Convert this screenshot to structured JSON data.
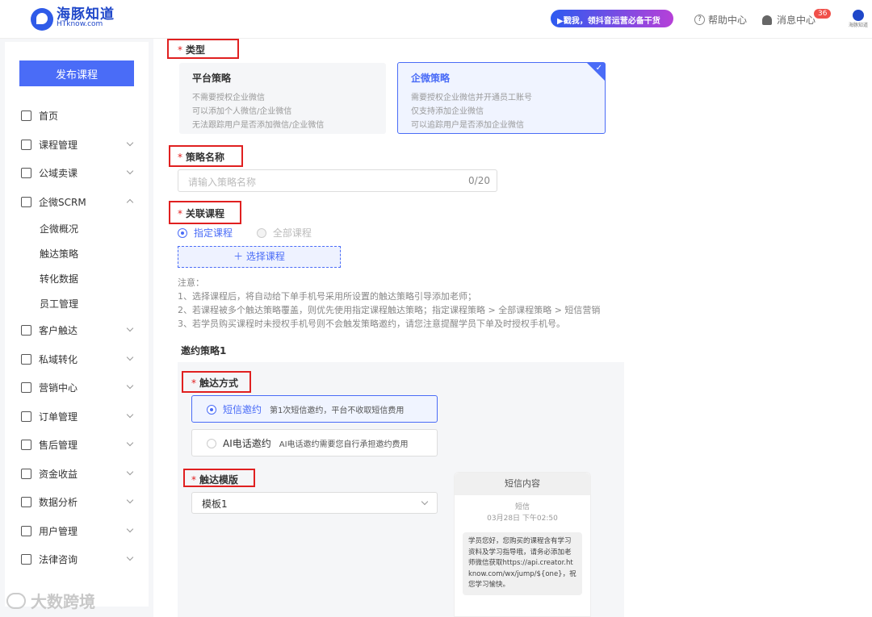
{
  "header": {
    "logo_title": "海豚知道",
    "logo_sub": "HTknow.com",
    "promo": "▶戳我，领抖音运营必备干货",
    "help": "帮助中心",
    "messages": "消息中心",
    "message_count": "36",
    "avatar_text": "海豚知道"
  },
  "sidebar": {
    "publish_button": "发布课程",
    "items": [
      {
        "label": "首页",
        "icon": "home-icon"
      },
      {
        "label": "课程管理",
        "icon": "course-icon"
      },
      {
        "label": "公域卖课",
        "icon": "public-sale-icon"
      },
      {
        "label": "企微SCRM",
        "icon": "scrm-icon"
      },
      {
        "label": "客户触达",
        "icon": "reach-icon"
      },
      {
        "label": "私域转化",
        "icon": "convert-icon"
      },
      {
        "label": "营销中心",
        "icon": "marketing-icon"
      },
      {
        "label": "订单管理",
        "icon": "order-icon"
      },
      {
        "label": "售后管理",
        "icon": "aftersale-icon"
      },
      {
        "label": "资金收益",
        "icon": "money-icon"
      },
      {
        "label": "数据分析",
        "icon": "chart-icon"
      },
      {
        "label": "用户管理",
        "icon": "user-icon"
      },
      {
        "label": "法律咨询",
        "icon": "legal-icon"
      }
    ],
    "sub_items": [
      "企微概况",
      "触达策略",
      "转化数据",
      "员工管理"
    ]
  },
  "form": {
    "type_label": "类型",
    "cards": [
      {
        "title": "平台策略",
        "lines": [
          "不需要授权企业微信",
          "可以添加个人微信/企业微信",
          "无法跟踪用户是否添加微信/企业微信"
        ]
      },
      {
        "title": "企微策略",
        "lines": [
          "需要授权企业微信并开通员工账号",
          "仅支持添加企业微信",
          "可以追踪用户是否添加企业微信"
        ]
      }
    ],
    "name_label": "策略名称",
    "name_placeholder": "请输入策略名称",
    "name_counter": "0/20",
    "course_label": "关联课程",
    "course_opt1": "指定课程",
    "course_opt2": "全部课程",
    "select_course": "＋  选择课程",
    "notes": [
      "注意：",
      "1、选择课程后，将自动给下单手机号采用所设置的触达策略引导添加老师；",
      "2、若课程被多个触达策略覆盖，则优先使用指定课程触达策略；指定课程策略 > 全部课程策略 > 短信营销",
      "3、若学员购买课程时未授权手机号则不会触发策略邀约，请您注意提醒学员下单及时授权手机号。"
    ],
    "invite_title": "邀约策略1",
    "reach_label": "触达方式",
    "sms_label": "短信邀约",
    "sms_desc": "第1次短信邀约，平台不收取短信费用",
    "ai_label": "AI电话邀约",
    "ai_desc": "AI电话邀约需要您自行承担邀约费用",
    "template_label": "触达模版",
    "template_value": "模板1",
    "preview_title": "短信内容",
    "preview_sender": "短信",
    "preview_time": "03月28日 下午02:50",
    "preview_body": "学员您好，您购买的课程含有学习资料及学习指导哦，请务必添加老师微信获取https://api.creator.htknow.com/wx/jump/${one}，祝您学习愉快。"
  },
  "watermark": "大数跨境"
}
